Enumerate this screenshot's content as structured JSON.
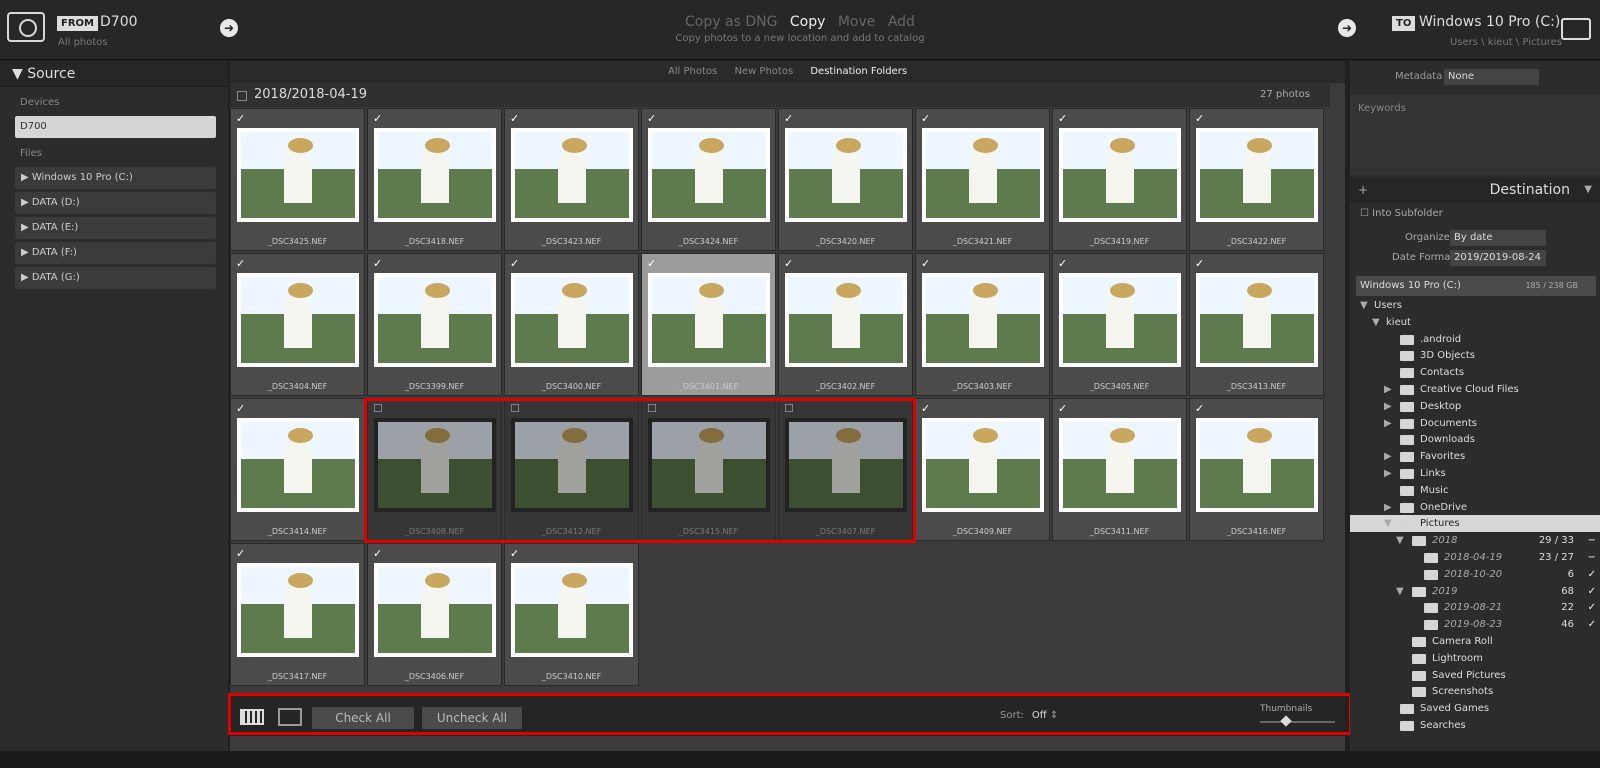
{
  "header": {
    "from_badge": "FROM",
    "source_device": "D700",
    "source_sub": "All photos",
    "modes": [
      "Copy as DNG",
      "Copy",
      "Move",
      "Add"
    ],
    "active_mode": "Copy",
    "mode_sub": "Copy photos to a new location and add to catalog",
    "to_badge": "TO",
    "destination_drive": "Windows 10 Pro (C:)",
    "destination_path": "Users \\ kieut \\ Pictures"
  },
  "source_panel": {
    "title": "Source",
    "devices_label": "Devices",
    "device": "D700",
    "files_label": "Files",
    "drives": [
      "Windows 10 Pro (C:)",
      "DATA (D:)",
      "DATA (E:)",
      "DATA (F:)",
      "DATA (G:)"
    ]
  },
  "view_tabs": [
    "All Photos",
    "New Photos",
    "Destination Folders"
  ],
  "active_tab": "Destination Folders",
  "folder_header": {
    "path": "2018/2018-04-19",
    "count": "27 photos"
  },
  "photos": [
    {
      "name": "_DSC3425.NEF",
      "checked": true
    },
    {
      "name": "_DSC3418.NEF",
      "checked": true
    },
    {
      "name": "_DSC3423.NEF",
      "checked": true
    },
    {
      "name": "_DSC3424.NEF",
      "checked": true
    },
    {
      "name": "_DSC3420.NEF",
      "checked": true
    },
    {
      "name": "_DSC3421.NEF",
      "checked": true
    },
    {
      "name": "_DSC3419.NEF",
      "checked": true
    },
    {
      "name": "_DSC3422.NEF",
      "checked": true
    },
    {
      "name": "_DSC3404.NEF",
      "checked": true
    },
    {
      "name": "_DSC3399.NEF",
      "checked": true
    },
    {
      "name": "_DSC3400.NEF",
      "checked": true
    },
    {
      "name": "_DSC3401.NEF",
      "checked": true,
      "selected": true
    },
    {
      "name": "_DSC3402.NEF",
      "checked": true
    },
    {
      "name": "_DSC3403.NEF",
      "checked": true
    },
    {
      "name": "_DSC3405.NEF",
      "checked": true
    },
    {
      "name": "_DSC3413.NEF",
      "checked": true
    },
    {
      "name": "_DSC3414.NEF",
      "checked": true
    },
    {
      "name": "_DSC3408.NEF",
      "checked": false
    },
    {
      "name": "_DSC3412.NEF",
      "checked": false
    },
    {
      "name": "_DSC3415.NEF",
      "checked": false
    },
    {
      "name": "_DSC3407.NEF",
      "checked": false
    },
    {
      "name": "_DSC3409.NEF",
      "checked": true
    },
    {
      "name": "_DSC3411.NEF",
      "checked": true
    },
    {
      "name": "_DSC3416.NEF",
      "checked": true
    },
    {
      "name": "_DSC3417.NEF",
      "checked": true
    },
    {
      "name": "_DSC3406.NEF",
      "checked": true
    },
    {
      "name": "_DSC3410.NEF",
      "checked": true
    }
  ],
  "toolbar": {
    "check_all": "Check All",
    "uncheck_all": "Uncheck All",
    "sort_label": "Sort:",
    "sort_value": "Off",
    "thumbnails_label": "Thumbnails",
    "thumbnail_size": 0.35
  },
  "right_panel": {
    "metadata_label": "Metadata",
    "metadata_value": "None",
    "keywords_label": "Keywords",
    "destination_title": "Destination",
    "into_subfolder": "Into Subfolder",
    "organize_label": "Organize",
    "organize_value": "By date",
    "date_format_label": "Date Format",
    "date_format_value": "2019/2019-08-24",
    "drive": "Windows 10 Pro (C:)",
    "drive_space": "185 / 238 GB",
    "tree": [
      {
        "label": "Users",
        "level": 0,
        "tri": "▼"
      },
      {
        "label": "kieut",
        "level": 1,
        "tri": "▼"
      },
      {
        "label": ".android",
        "level": 2
      },
      {
        "label": "3D Objects",
        "level": 2
      },
      {
        "label": "Contacts",
        "level": 2
      },
      {
        "label": "Creative Cloud Files",
        "level": 2,
        "tri": "▶"
      },
      {
        "label": "Desktop",
        "level": 2,
        "tri": "▶"
      },
      {
        "label": "Documents",
        "level": 2,
        "tri": "▶"
      },
      {
        "label": "Downloads",
        "level": 2
      },
      {
        "label": "Favorites",
        "level": 2,
        "tri": "▶"
      },
      {
        "label": "Links",
        "level": 2,
        "tri": "▶"
      },
      {
        "label": "Music",
        "level": 2
      },
      {
        "label": "OneDrive",
        "level": 2,
        "tri": "▶"
      },
      {
        "label": "Pictures",
        "level": 2,
        "tri": "▼",
        "selected": true
      },
      {
        "label": "2018",
        "level": 3,
        "tri": "▼",
        "italic": true,
        "count": "29 / 33",
        "mark": "−"
      },
      {
        "label": "2018-04-19",
        "level": 4,
        "italic": true,
        "count": "23 / 27",
        "mark": "−"
      },
      {
        "label": "2018-10-20",
        "level": 4,
        "italic": true,
        "count": "6",
        "mark": "✓"
      },
      {
        "label": "2019",
        "level": 3,
        "tri": "▼",
        "italic": true,
        "count": "68",
        "mark": "✓"
      },
      {
        "label": "2019-08-21",
        "level": 4,
        "italic": true,
        "count": "22",
        "mark": "✓"
      },
      {
        "label": "2019-08-23",
        "level": 4,
        "italic": true,
        "count": "46",
        "mark": "✓"
      },
      {
        "label": "Camera Roll",
        "level": 3
      },
      {
        "label": "Lightroom",
        "level": 3
      },
      {
        "label": "Saved Pictures",
        "level": 3
      },
      {
        "label": "Screenshots",
        "level": 3
      },
      {
        "label": "Saved Games",
        "level": 2
      },
      {
        "label": "Searches",
        "level": 2
      }
    ]
  },
  "colors": {
    "highlight": "#e00000",
    "panel": "#2c2c2c",
    "grid": "#3b3b3b"
  }
}
